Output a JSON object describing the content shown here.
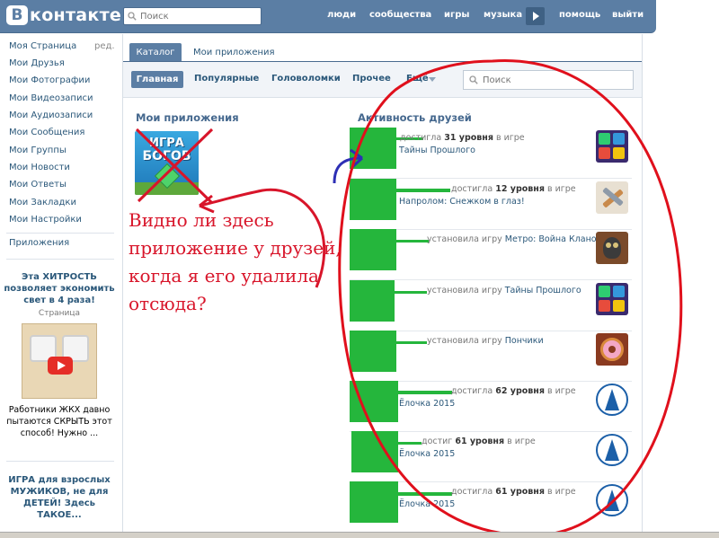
{
  "header": {
    "logo_mark": "В",
    "logo_text": "контакте",
    "search_placeholder": "Поиск",
    "nav": [
      "люди",
      "сообщества",
      "игры",
      "музыка",
      "помощь",
      "выйти"
    ]
  },
  "sidebar": {
    "items": [
      "Моя Страница",
      "Мои Друзья",
      "Мои Фотографии",
      "Мои Видеозаписи",
      "Мои Аудиозаписи",
      "Мои Сообщения",
      "Мои Группы",
      "Мои Новости",
      "Мои Ответы",
      "Мои Закладки",
      "Мои Настройки"
    ],
    "edit_label": "ред.",
    "apps_label": "Приложения",
    "promo1": {
      "title": "Эта ХИТРОСТЬ позволяет экономить свет в 4 раза!",
      "subtitle": "Страница",
      "text": "Работники ЖКХ давно пытаются СКРЫТЬ этот способ! Нужно ..."
    },
    "promo2": {
      "title": "ИГРА для взрослых МУЖИКОВ, не для ДЕТЕЙ! Здесь ТАКОЕ..."
    }
  },
  "tabs": [
    "Каталог",
    "Мои приложения"
  ],
  "subnav": {
    "items": [
      "Главная",
      "Популярные",
      "Головоломки",
      "Прочее",
      "Ещё"
    ],
    "search_placeholder": "Поиск"
  },
  "my_apps": {
    "title": "Мои приложения",
    "app_line1": "ИГРА",
    "app_line2": "БОГОВ"
  },
  "friends_activity": {
    "title": "Активность друзей",
    "items": [
      {
        "pre": "достигла ",
        "bold": "31 уровня",
        "post": " в игре",
        "game": "Тайны Прошлого",
        "icon": "jewels-game-icon"
      },
      {
        "pre": "достигла ",
        "bold": "12 уровня",
        "post": " в игре",
        "game": "Напролом: Снежком в глаз!",
        "icon": "snowball-game-icon"
      },
      {
        "pre": "установила игру ",
        "bold": "",
        "post": "",
        "game": "Метро: Война Кланов",
        "icon": "metro-game-icon"
      },
      {
        "pre": "установила игру ",
        "bold": "",
        "post": "",
        "game": "Тайны Прошлого",
        "icon": "jewels-game-icon"
      },
      {
        "pre": "установила игру ",
        "bold": "",
        "post": "",
        "game": "Пончики",
        "icon": "donut-game-icon"
      },
      {
        "pre": "достигла ",
        "bold": "62 уровня",
        "post": " в игре",
        "game": "Ёлочка 2015",
        "icon": "christmas-tree-game-icon"
      },
      {
        "pre": "достиг ",
        "bold": "61 уровня",
        "post": " в игре",
        "game": "Ёлочка 2015",
        "icon": "christmas-tree-game-icon"
      },
      {
        "pre": "достигла ",
        "bold": "61 уровня",
        "post": " в игре",
        "game": "Ёлочка 2015",
        "icon": "christmas-tree-game-icon"
      }
    ]
  },
  "annotation": {
    "text": "Видно ли здесь приложение у друзей, когда я его удалила отсюда?"
  },
  "colors": {
    "brand": "#5b7ea4",
    "link": "#2b587a",
    "annotation": "#d8152a",
    "redaction": "#25b63c"
  }
}
